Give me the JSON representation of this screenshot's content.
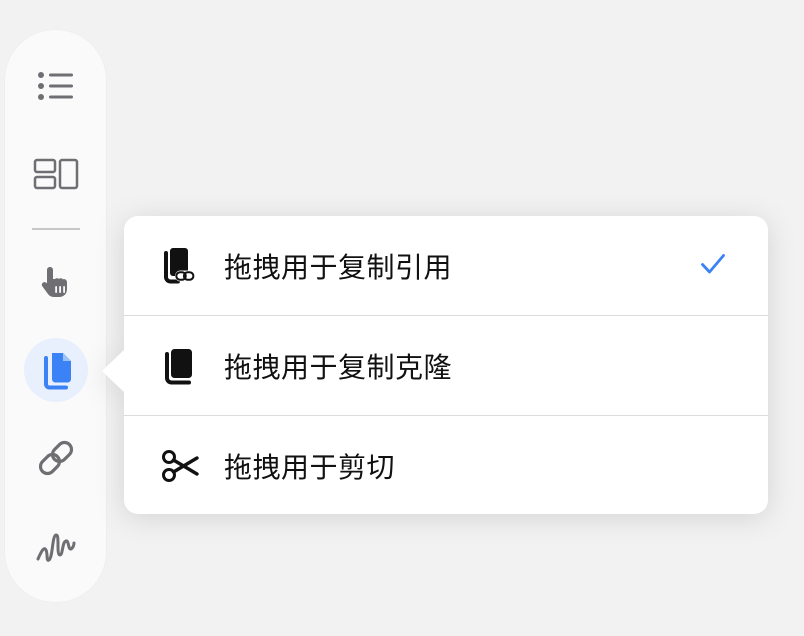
{
  "toolbar": {
    "tools": [
      {
        "name": "list-icon"
      },
      {
        "name": "layout-icon"
      },
      {
        "name": "hand-pointer-icon"
      },
      {
        "name": "copy-icon",
        "active": true
      },
      {
        "name": "link-icon"
      },
      {
        "name": "squiggle-icon"
      }
    ],
    "accent_color": "#3b82f6"
  },
  "drag_menu": {
    "items": [
      {
        "label": "拖拽用于复制引用",
        "icon": "book-link-icon",
        "checked": true
      },
      {
        "label": "拖拽用于复制克隆",
        "icon": "book-stack-icon",
        "checked": false
      },
      {
        "label": "拖拽用于剪切",
        "icon": "scissors-icon",
        "checked": false
      }
    ],
    "check_color": "#3b82f6"
  }
}
